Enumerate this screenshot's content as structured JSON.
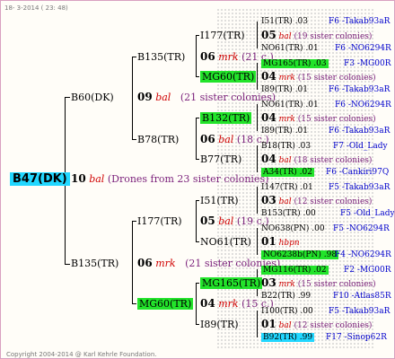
{
  "header": {
    "date": "18-  3-2014 ( 23: 48)"
  },
  "footer": {
    "copyright": "Copyright 2004-2014 @ Karl Kehrle Foundation."
  },
  "root": {
    "name": "B47(DK)",
    "num": "10",
    "race": "bal",
    "note": "(Drones from 23 sister colonies)"
  },
  "l1": [
    {
      "name": "B60(DK)",
      "num": "09",
      "race": "bal",
      "note": "(21 sister colonies)"
    },
    {
      "name": "B135(TR)",
      "num": "06",
      "race": "mrk",
      "note": "(21 sister colonies)"
    }
  ],
  "l2": [
    {
      "name": "B135(TR)",
      "num": "06",
      "race": "mrk",
      "note": "(21 c.)"
    },
    {
      "name": "B78(TR)",
      "num": "06",
      "race": "bal",
      "note": "(18 c.)"
    },
    {
      "name": "I177(TR)",
      "num": "05",
      "race": "bal",
      "note": "(19 c.)"
    },
    {
      "name": "MG60(TR)",
      "num": "04",
      "race": "mrk",
      "note": "(15 c.)"
    }
  ],
  "l3": [
    {
      "name": "I177(TR)"
    },
    {
      "name": "MG60(TR)"
    },
    {
      "name": "B132(TR)"
    },
    {
      "name": "B77(TR)"
    },
    {
      "name": "I51(TR)"
    },
    {
      "name": "NO61(TR)"
    },
    {
      "name": "MG165(TR)"
    },
    {
      "name": "I89(TR)"
    }
  ],
  "l4": [
    {
      "name": "I51(TR)",
      "val": ".03",
      "loc": "F6 -Takab93aR"
    },
    {
      "num": "05",
      "race": "bal",
      "note": "(19 sister colonies)"
    },
    {
      "name": "NO61(TR)",
      "val": ".01",
      "loc": "F6 -NO6294R"
    },
    {
      "name": "MG165(TR)",
      "val": ".03",
      "loc": "F3 -MG00R"
    },
    {
      "num": "04",
      "race": "mrk",
      "note": "(15 sister colonies)"
    },
    {
      "name": "I89(TR)",
      "val": ".01",
      "loc": "F6 -Takab93aR"
    },
    {
      "name": "NO61(TR)",
      "val": ".01",
      "loc": "F6 -NO6294R"
    },
    {
      "num": "04",
      "race": "mrk",
      "note": "(15 sister colonies)"
    },
    {
      "name": "I89(TR)",
      "val": ".01",
      "loc": "F6 -Takab93aR"
    },
    {
      "name": "B18(TR)",
      "val": ".03",
      "loc": "F7 -Old_Lady"
    },
    {
      "num": "04",
      "race": "bal",
      "note": "(18 sister colonies)"
    },
    {
      "name": "A34(TR)",
      "val": ".02",
      "loc": "F6 -Cankiri97Q"
    },
    {
      "name": "I147(TR)",
      "val": ".01",
      "loc": "F5 -Takab93aR"
    },
    {
      "num": "03",
      "race": "bal",
      "note": "(12 sister colonies)"
    },
    {
      "name": "B153(TR)",
      "val": ".00",
      "loc": "F5 -Old_Lady"
    },
    {
      "name": "NO638(PN)",
      "val": ".00",
      "loc": "F5 -NO6294R"
    },
    {
      "num": "01",
      "race": "hbpn",
      "note": ""
    },
    {
      "name": "NO6238b(PN)",
      "val": ".98",
      "loc": "F4 -NO6294R"
    },
    {
      "name": "MG116(TR)",
      "val": ".02",
      "loc": "F2 -MG00R"
    },
    {
      "num": "03",
      "race": "mrk",
      "note": "(15 sister colonies)"
    },
    {
      "name": "B22(TR)",
      "val": ".99",
      "loc": "F10 -Atlas85R"
    },
    {
      "name": "I100(TR)",
      "val": ".00",
      "loc": "F5 -Takab93aR"
    },
    {
      "num": "01",
      "race": "bal",
      "note": "(12 sister colonies)"
    },
    {
      "name": "B92(TR)",
      "val": ".99",
      "loc": "F17 -Sinop62R"
    }
  ]
}
